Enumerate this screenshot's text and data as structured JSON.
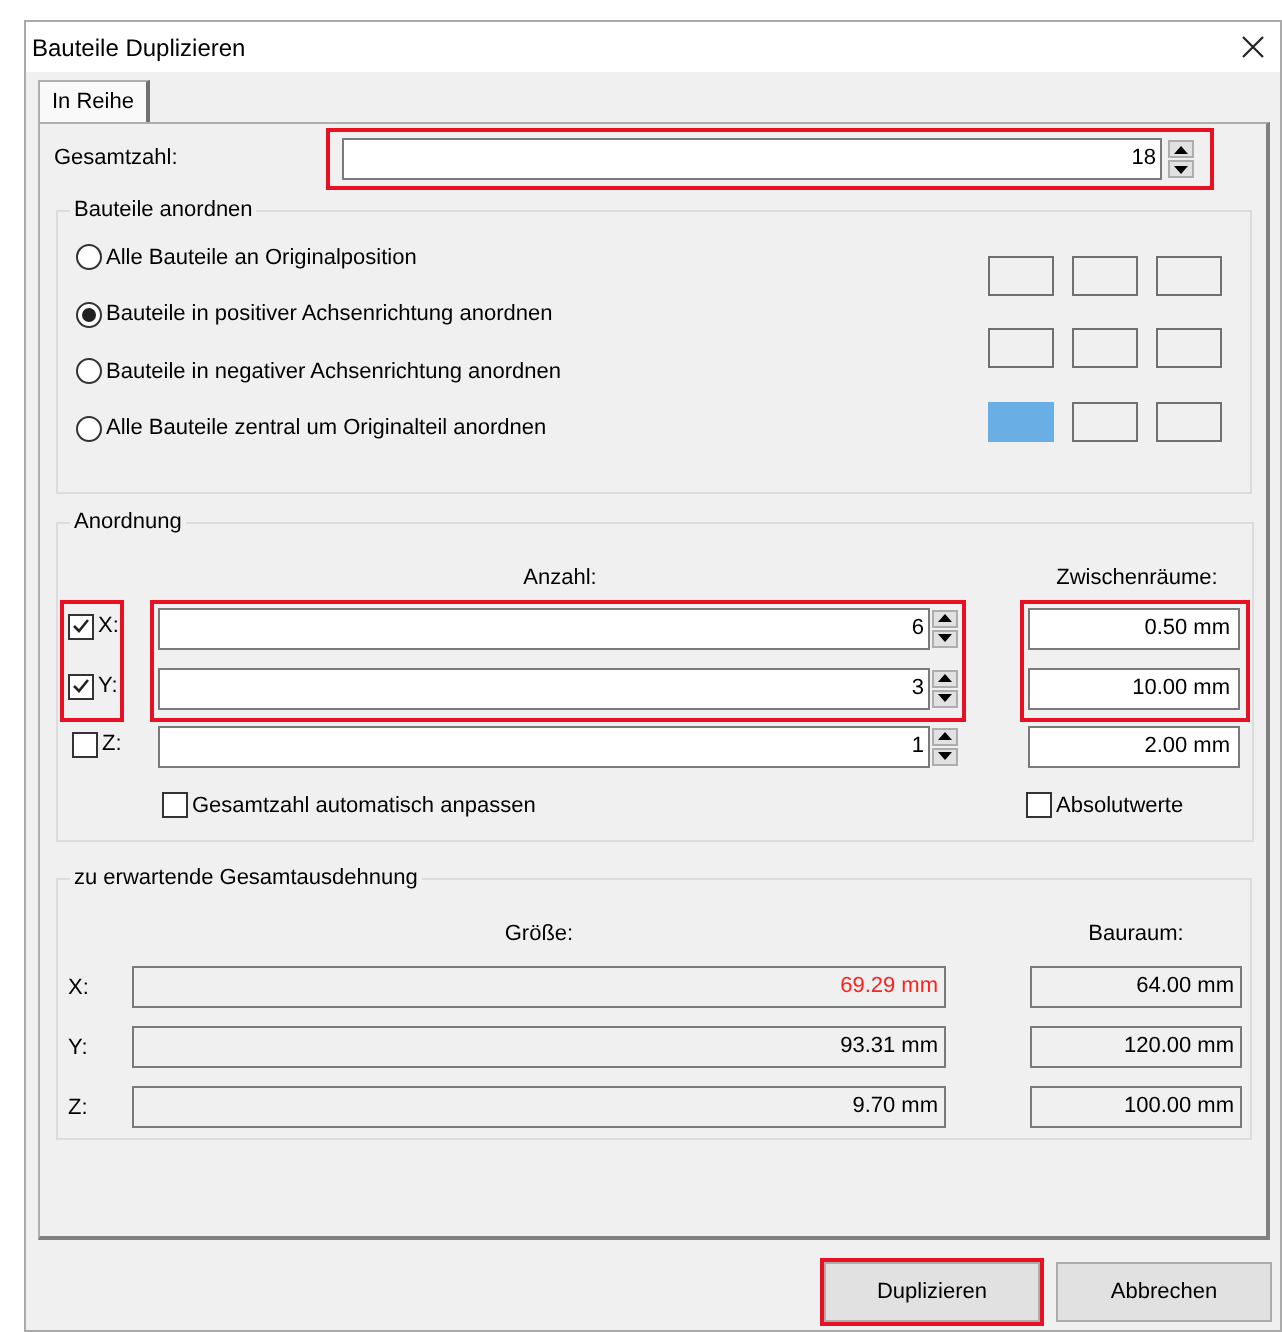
{
  "window": {
    "title": "Bauteile Duplizieren"
  },
  "tabs": [
    {
      "label": "In Reihe",
      "selected": true
    }
  ],
  "total": {
    "label": "Gesamtzahl:",
    "value": "18",
    "highlighted": true
  },
  "arrange": {
    "title": "Bauteile anordnen",
    "options": [
      {
        "label": "Alle Bauteile an Originalposition",
        "selected": false
      },
      {
        "label": "Bauteile in positiver Achsenrichtung anordnen",
        "selected": true
      },
      {
        "label": "Bauteile in negativer Achsenrichtung anordnen",
        "selected": false
      },
      {
        "label": "Alle Bauteile zentral um Originalteil anordnen",
        "selected": false
      }
    ],
    "grid": [
      {
        "selected": false
      },
      {
        "selected": false
      },
      {
        "selected": false
      },
      {
        "selected": false
      },
      {
        "selected": false
      },
      {
        "selected": false
      },
      {
        "selected": true
      },
      {
        "selected": false
      },
      {
        "selected": false
      }
    ]
  },
  "layout": {
    "title": "Anordnung",
    "count_header": "Anzahl:",
    "gap_header": "Zwischenräume:",
    "xy_highlighted": true,
    "rows": [
      {
        "label": "X:",
        "checked": true,
        "count": "6",
        "gap": "0.50 mm"
      },
      {
        "label": "Y:",
        "checked": true,
        "count": "3",
        "gap": "10.00 mm"
      },
      {
        "label": "Z:",
        "checked": false,
        "count": "1",
        "gap": "2.00 mm"
      }
    ],
    "auto_adjust": {
      "label": "Gesamtzahl automatisch anpassen",
      "checked": false
    },
    "absolute": {
      "label": "Absolutwerte",
      "checked": false
    }
  },
  "extent": {
    "title": "zu erwartende Gesamtausdehnung",
    "size_header": "Größe:",
    "space_header": "Bauraum:",
    "rows": [
      {
        "label": "X:",
        "size": "69.29 mm",
        "exceeds": true,
        "space": "64.00 mm"
      },
      {
        "label": "Y:",
        "size": "93.31 mm",
        "exceeds": false,
        "space": "120.00 mm"
      },
      {
        "label": "Z:",
        "size": "9.70 mm",
        "exceeds": false,
        "space": "100.00 mm"
      }
    ]
  },
  "buttons": [
    {
      "label": "Duplizieren",
      "highlighted": true
    },
    {
      "label": "Abbrechen",
      "highlighted": false
    }
  ]
}
